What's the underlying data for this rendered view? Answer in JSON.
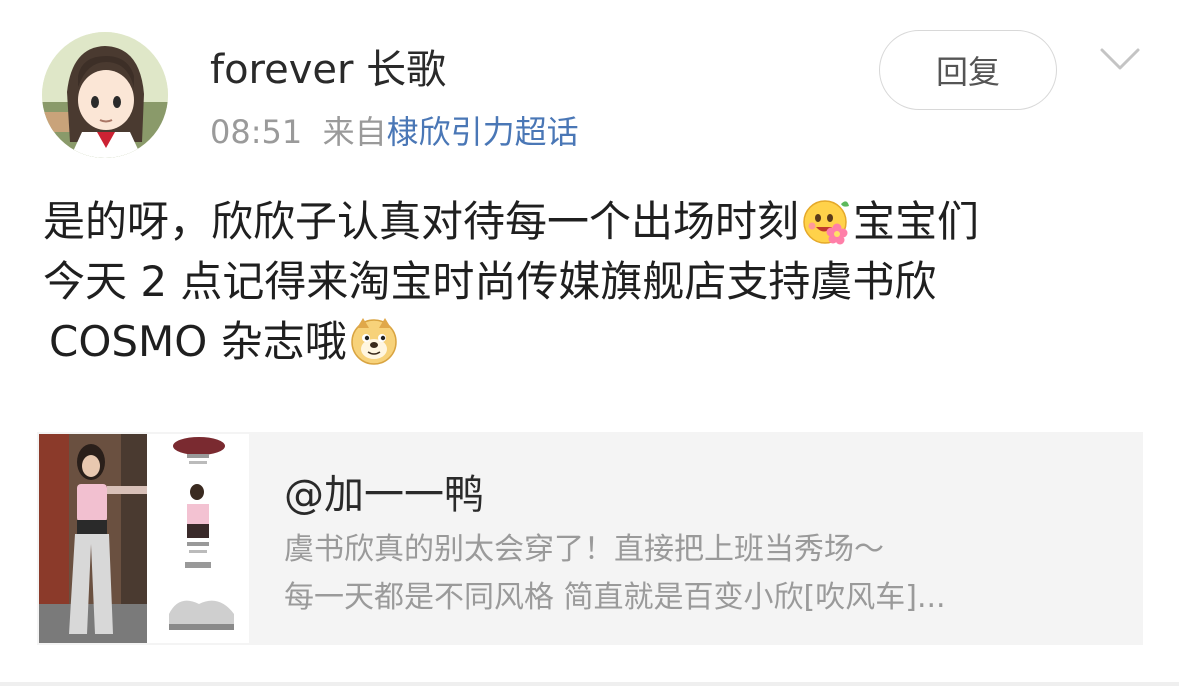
{
  "post": {
    "username": "forever 长歌",
    "time": "08:51",
    "source_prefix": "来自",
    "source_link": "棣欣引力超话",
    "reply_label": "回复",
    "content_line1a": "是的呀，欣欣子认真对待每一个出场时刻",
    "content_line1b": "宝宝们",
    "content_line2": "今天 2 点记得来淘宝时尚传媒旗舰店支持虞书欣",
    "content_line3": "COSMO 杂志哦"
  },
  "card": {
    "title": "@加一一鸭",
    "desc_line1": "虞书欣真的别太会穿了！直接把上班当秀场～",
    "desc_line2": "每一天都是不同风格 简直就是百变小欣[吹风车]..."
  },
  "colors": {
    "link": "#4a77b6",
    "meta": "#9a9a9a",
    "card_bg": "#f4f4f4"
  },
  "icons": [
    "chevron-down-icon",
    "flower-smile-emoji",
    "doge-emoji"
  ]
}
